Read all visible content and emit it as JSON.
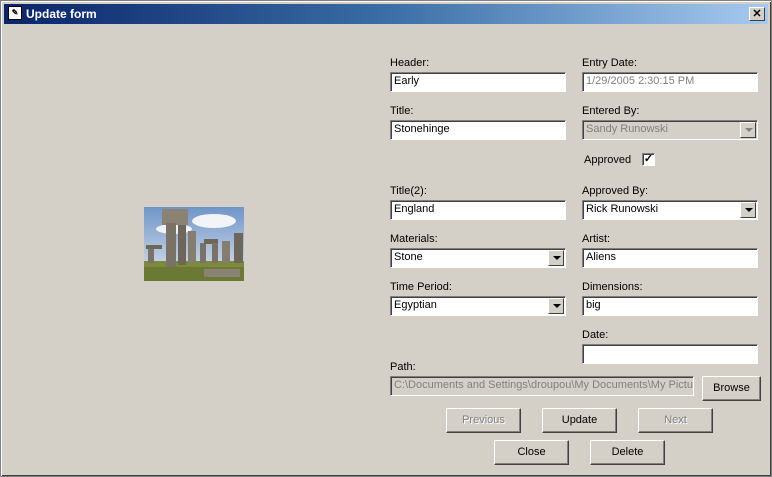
{
  "window": {
    "title": "Update form",
    "close_glyph": "✕"
  },
  "image": {
    "description_icon": "stonehenge-photo"
  },
  "labels": {
    "header": "Header:",
    "entry_date": "Entry Date:",
    "title": "Title:",
    "entered_by": "Entered By:",
    "approved": "Approved",
    "title2": "Title(2):",
    "approved_by": "Approved By:",
    "materials": "Materials:",
    "artist": "Artist:",
    "time_period": "Time Period:",
    "dimensions": "Dimensions:",
    "date": "Date:",
    "path": "Path:"
  },
  "fields": {
    "header": "Early",
    "entry_date": "1/29/2005 2:30:15 PM",
    "title": "Stonehinge",
    "entered_by": "Sandy Runowski",
    "approved": true,
    "title2": "England",
    "approved_by": "Rick Runowski",
    "materials": "Stone",
    "artist": "Aliens",
    "time_period": "Egyptian",
    "dimensions": "big",
    "date": "",
    "path": "C:\\Documents and Settings\\droupou\\My Documents\\My Pictures"
  },
  "buttons": {
    "browse": "Browse",
    "previous": "Previous",
    "update": "Update",
    "next": "Next",
    "close": "Close",
    "delete": "Delete"
  },
  "colors": {
    "face": "#d4d0c8",
    "title_start": "#0a246a",
    "title_end": "#a6caf0"
  }
}
